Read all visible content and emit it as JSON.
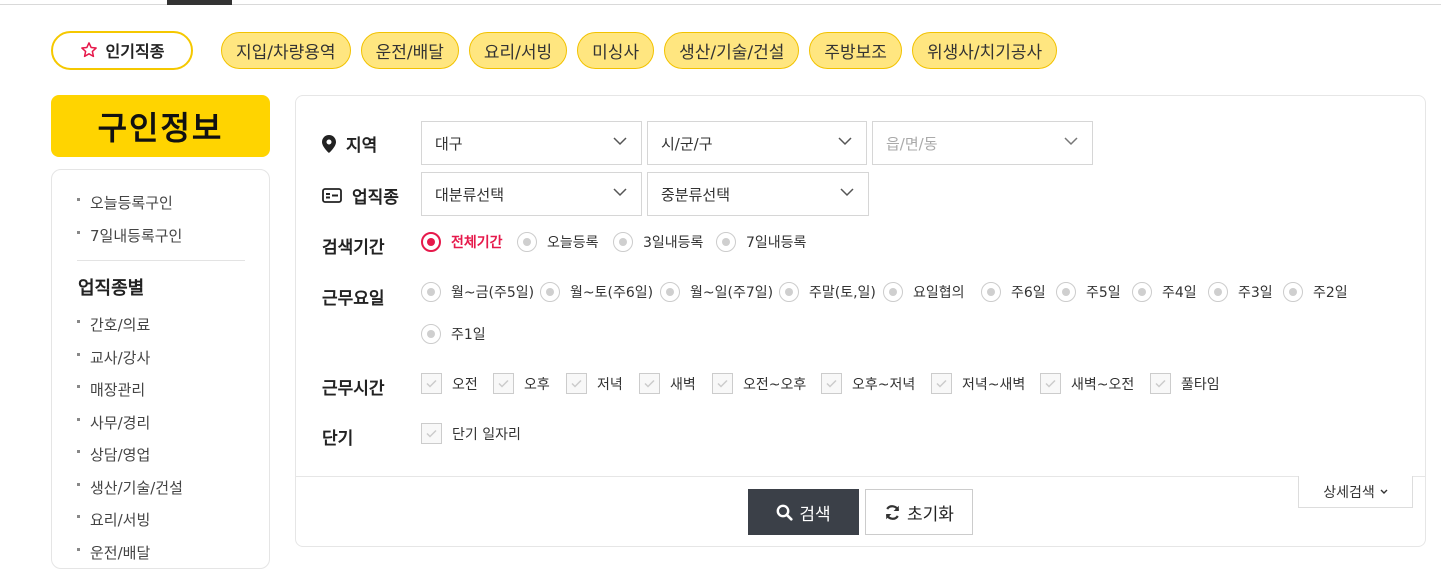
{
  "popular_chip": {
    "label": "인기직종"
  },
  "category_chips": [
    "지입/차량용역",
    "운전/배달",
    "요리/서빙",
    "미싱사",
    "생산/기술/건설",
    "주방보조",
    "위생사/치기공사"
  ],
  "sidebar": {
    "title": "구인정보",
    "quick_links": [
      "오늘등록구인",
      "7일내등록구인"
    ],
    "section_title": "업직종별",
    "categories": [
      "간호/의료",
      "교사/강사",
      "매장관리",
      "사무/경리",
      "상담/영업",
      "생산/기술/건설",
      "요리/서빙",
      "운전/배달"
    ]
  },
  "search": {
    "region_label": "지역",
    "region_city": "대구",
    "region_district": "시/군/구",
    "region_town": "읍/면/동",
    "job_label": "업직종",
    "job_major": "대분류선택",
    "job_minor": "중분류선택",
    "period_label": "검색기간",
    "period_options": [
      "전체기간",
      "오늘등록",
      "3일내등록",
      "7일내등록"
    ],
    "period_selected": "전체기간",
    "days_label": "근무요일",
    "days_options": [
      "월~금(주5일)",
      "월~토(주6일)",
      "월~일(주7일)",
      "주말(토,일)",
      "요일협의",
      "주6일",
      "주5일",
      "주4일",
      "주3일",
      "주2일",
      "주1일"
    ],
    "hours_label": "근무시간",
    "hours_options": [
      "오전",
      "오후",
      "저녁",
      "새벽",
      "오전~오후",
      "오후~저녁",
      "저녁~새벽",
      "새벽~오전",
      "풀타임"
    ],
    "short_label": "단기",
    "short_options": [
      "단기 일자리"
    ],
    "search_button": "검색",
    "reset_button": "초기화",
    "detail_button": "상세검색"
  },
  "colors": {
    "accent_yellow": "#ffd400",
    "chip_yellow": "#ffe680",
    "selected_red": "#e6194b",
    "button_dark": "#3b4048"
  }
}
